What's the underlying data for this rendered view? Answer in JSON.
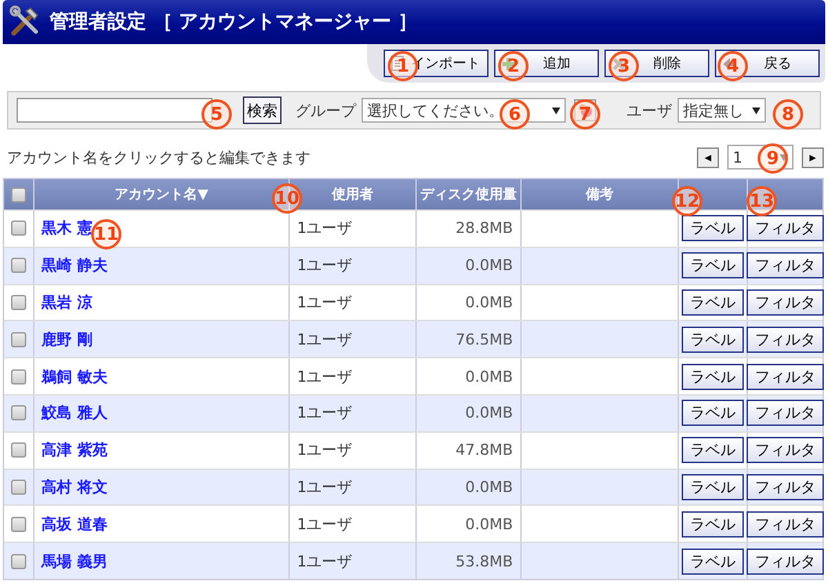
{
  "window": {
    "title": "管理者設定 ［ アカウントマネージャー ］"
  },
  "toolbar": [
    {
      "label": "インポート",
      "kind": "import"
    },
    {
      "label": "追加",
      "kind": "add"
    },
    {
      "label": "削除",
      "kind": "delete"
    },
    {
      "label": "戻る",
      "kind": "back"
    }
  ],
  "search": {
    "button": "検索",
    "group_label": "グループ",
    "group_value": "選択してください。",
    "user_label": "ユーザ",
    "user_value": "指定無し"
  },
  "hint": "アカウント名をクリックすると編集できます",
  "pager": {
    "prev": "◄",
    "value": "1",
    "next": "►"
  },
  "table": {
    "select_all": {
      "checked": false
    },
    "columns": [
      "アカウント名▼",
      "使用者",
      "ディスク使用量",
      "備考"
    ],
    "rows": [
      {
        "checked": false,
        "name": "黒木 憲",
        "users": "1ユーザ",
        "disk": "28.8MB",
        "label_button": "ラベル",
        "filter_button": "フィルタ"
      },
      {
        "checked": false,
        "name": "黒崎 静夫",
        "users": "1ユーザ",
        "disk": "0.0MB",
        "label_button": "ラベル",
        "filter_button": "フィルタ"
      },
      {
        "checked": false,
        "name": "黒岩 涼",
        "users": "1ユーザ",
        "disk": "0.0MB",
        "label_button": "ラベル",
        "filter_button": "フィルタ"
      },
      {
        "checked": false,
        "name": "鹿野 剛",
        "users": "1ユーザ",
        "disk": "76.5MB",
        "label_button": "ラベル",
        "filter_button": "フィルタ"
      },
      {
        "checked": false,
        "name": "鵜飼 敏夫",
        "users": "1ユーザ",
        "disk": "0.0MB",
        "label_button": "ラベル",
        "filter_button": "フィルタ"
      },
      {
        "checked": false,
        "name": "鮫島 雅人",
        "users": "1ユーザ",
        "disk": "0.0MB",
        "label_button": "ラベル",
        "filter_button": "フィルタ"
      },
      {
        "checked": false,
        "name": "高津 紫苑",
        "users": "1ユーザ",
        "disk": "47.8MB",
        "label_button": "ラベル",
        "filter_button": "フィルタ"
      },
      {
        "checked": false,
        "name": "高村 将文",
        "users": "1ユーザ",
        "disk": "0.0MB",
        "label_button": "ラベル",
        "filter_button": "フィルタ"
      },
      {
        "checked": false,
        "name": "高坂 道春",
        "users": "1ユーザ",
        "disk": "0.0MB",
        "label_button": "ラベル",
        "filter_button": "フィルタ"
      },
      {
        "checked": false,
        "name": "馬場 義男",
        "users": "1ユーザ",
        "disk": "53.8MB",
        "label_button": "ラベル",
        "filter_button": "フィルタ"
      }
    ]
  },
  "callouts": [
    "1",
    "2",
    "3",
    "4",
    "5",
    "6",
    "7",
    "8",
    "9",
    "10",
    "11",
    "12",
    "13"
  ]
}
